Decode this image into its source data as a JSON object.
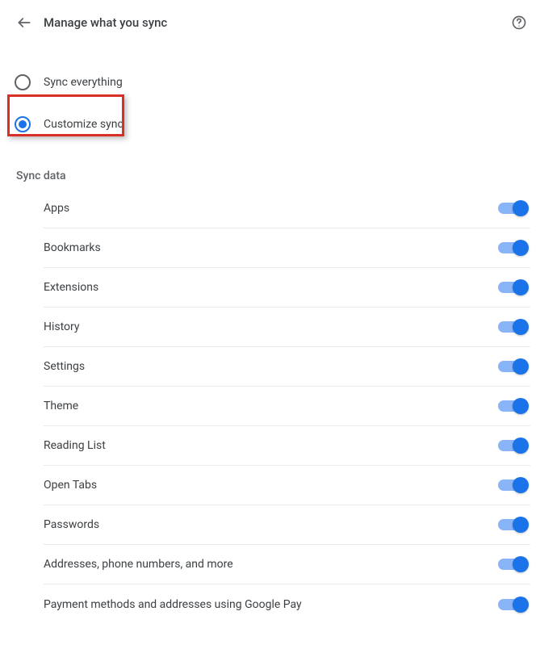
{
  "header": {
    "title": "Manage what you sync"
  },
  "radios": {
    "sync_everything": {
      "label": "Sync everything",
      "selected": false
    },
    "customize_sync": {
      "label": "Customize sync",
      "selected": true
    }
  },
  "section": {
    "title": "Sync data"
  },
  "items": [
    {
      "label": "Apps",
      "on": true
    },
    {
      "label": "Bookmarks",
      "on": true
    },
    {
      "label": "Extensions",
      "on": true
    },
    {
      "label": "History",
      "on": true
    },
    {
      "label": "Settings",
      "on": true
    },
    {
      "label": "Theme",
      "on": true
    },
    {
      "label": "Reading List",
      "on": true
    },
    {
      "label": "Open Tabs",
      "on": true
    },
    {
      "label": "Passwords",
      "on": true
    },
    {
      "label": "Addresses, phone numbers, and more",
      "on": true
    },
    {
      "label": "Payment methods and addresses using Google Pay",
      "on": true
    }
  ],
  "colors": {
    "accent": "#1a73e8",
    "highlight": "#d93025"
  }
}
